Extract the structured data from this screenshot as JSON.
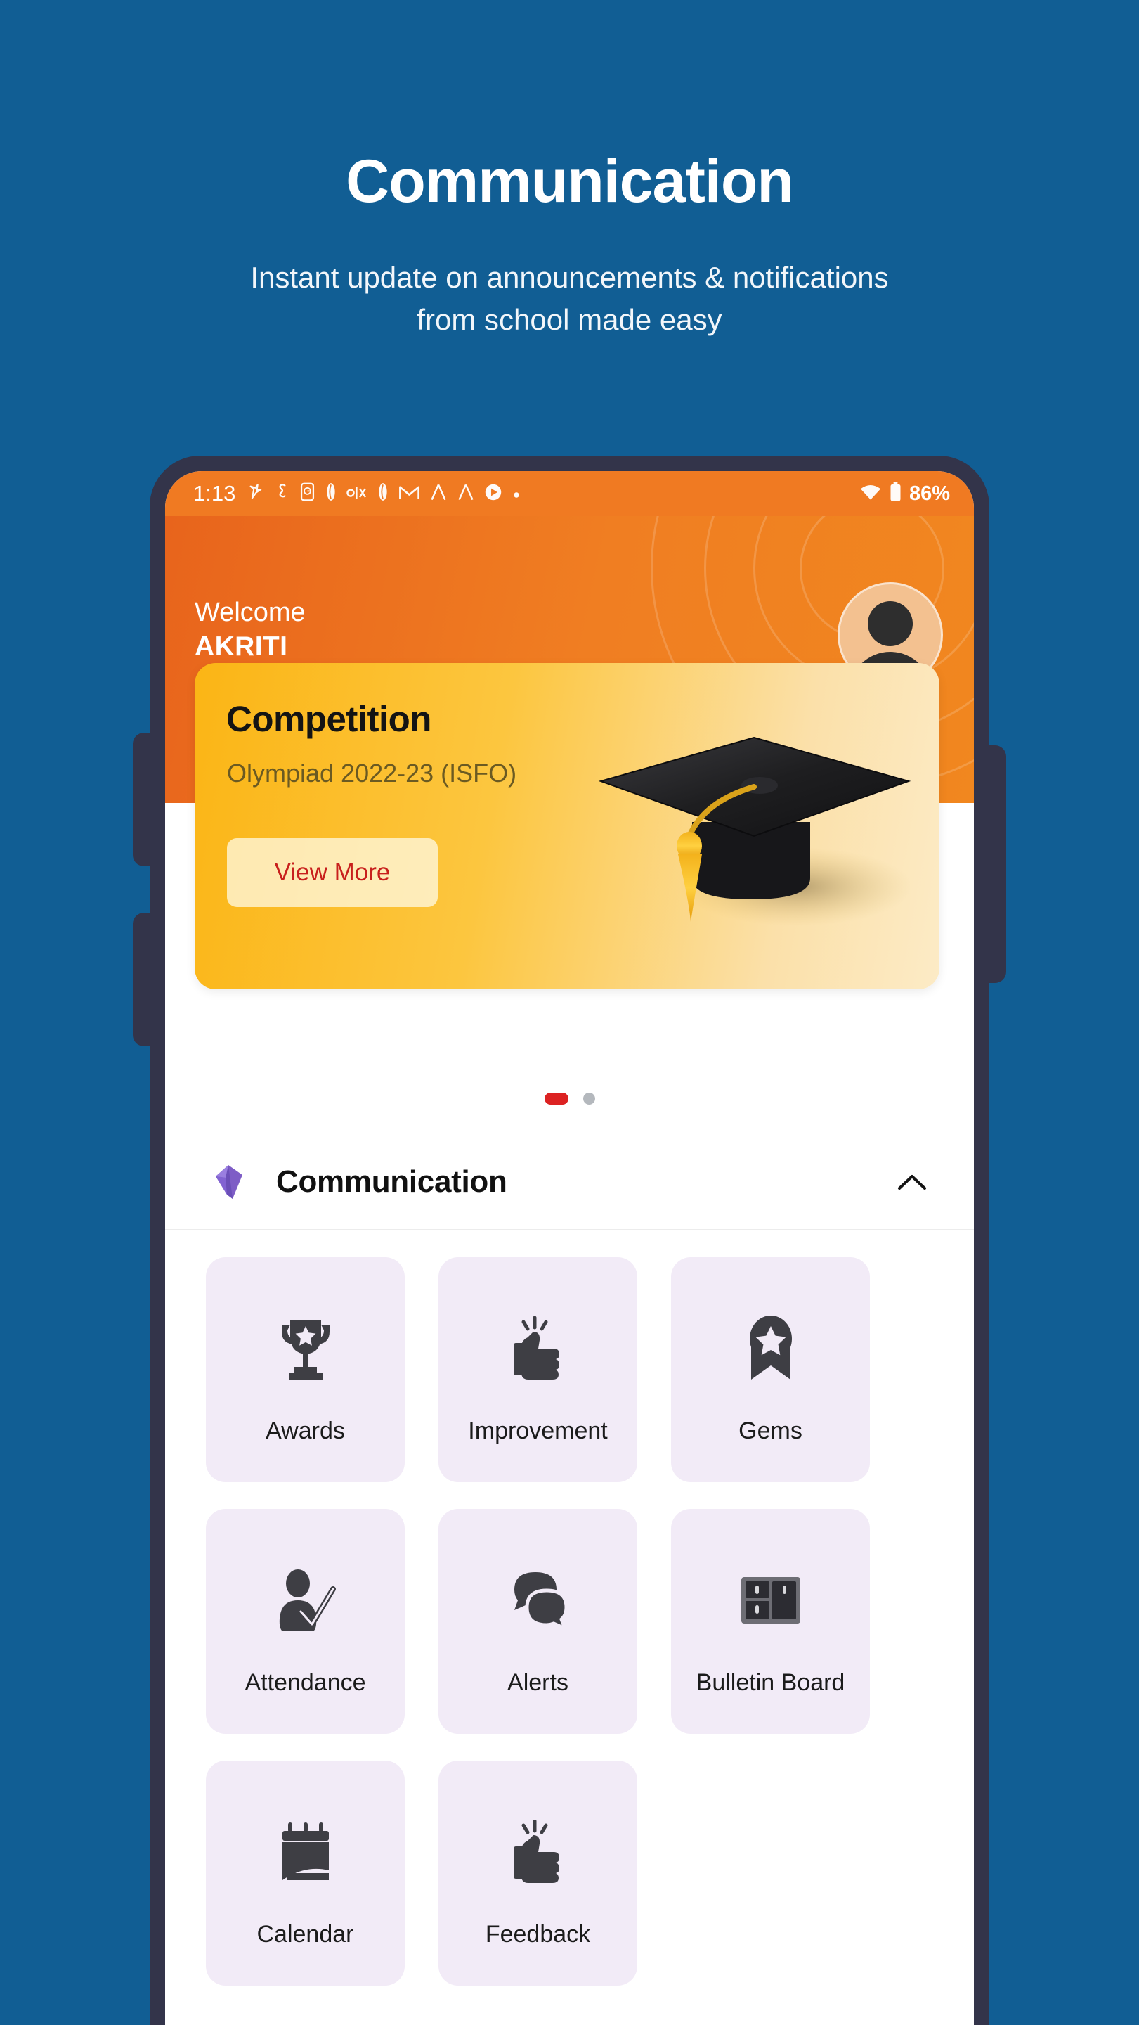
{
  "promo": {
    "title": "Communication",
    "subtitle_line1": "Instant update on announcements & notifications",
    "subtitle_line2": "from school made easy",
    "background_color": "#115E94"
  },
  "phone": {
    "frame_color": "#33344a",
    "statusbar": {
      "time": "1:13",
      "battery_percent": "86%",
      "icons": [
        "notification-app-icon",
        "snapchat-icon",
        "app-badge-icon",
        "feather-app-icon",
        "olx-icon",
        "feather-app-icon-2",
        "gmail-icon",
        "arrow-app-icon",
        "arrow-app-icon-2",
        "play-icon",
        "dot-icon"
      ],
      "right_icons": [
        "wifi-icon",
        "battery-icon"
      ]
    },
    "header": {
      "welcome_label": "Welcome",
      "user_name": "AKRITI",
      "accent_color": "#F07A22",
      "avatar_icon": "person-avatar-icon"
    },
    "promo_card": {
      "title": "Competition",
      "subtitle": "Olympiad 2022-23 (ISFO)",
      "button_label": "View More",
      "button_text_color": "#C8201D",
      "image_icon": "graduation-cap-image"
    },
    "carousel": {
      "active_index": 0,
      "total": 2,
      "active_color": "#DC2222",
      "inactive_color": "#B4B8BD"
    },
    "section": {
      "title": "Communication",
      "leading_icon": "gem-icon",
      "toggle_icon": "chevron-up-icon",
      "expanded": true
    },
    "tiles": [
      {
        "label": "Awards",
        "icon": "trophy-icon"
      },
      {
        "label": "Improvement",
        "icon": "thumbs-up-icon"
      },
      {
        "label": "Gems",
        "icon": "award-ribbon-icon"
      },
      {
        "label": "Attendance",
        "icon": "person-check-icon"
      },
      {
        "label": "Alerts",
        "icon": "speech-bubbles-icon"
      },
      {
        "label": "Bulletin Board",
        "icon": "bulletin-board-icon"
      },
      {
        "label": "Calendar",
        "icon": "calendar-icon"
      },
      {
        "label": "Feedback",
        "icon": "thumbs-up-icon"
      }
    ],
    "tile_background_color": "#F2EBF7"
  }
}
